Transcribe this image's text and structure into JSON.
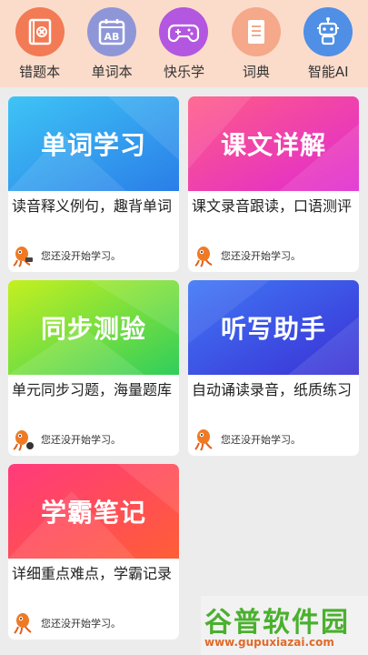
{
  "nav": {
    "items": [
      {
        "label": "错题本",
        "icon": "notebook-icon",
        "color": "#f27a55"
      },
      {
        "label": "单词本",
        "icon": "calendar-ab-icon",
        "color": "#8f96d8"
      },
      {
        "label": "快乐学",
        "icon": "gamepad-icon",
        "color": "#b356e0"
      },
      {
        "label": "词典",
        "icon": "book-icon",
        "color": "#f5a98a"
      },
      {
        "label": "智能AI",
        "icon": "robot-icon",
        "color": "#4f8fe6"
      }
    ]
  },
  "cards": [
    {
      "title": "单词学习",
      "desc": "读音释义例句，趣背单词",
      "status": "您还没开始学习。",
      "colors": [
        "#38b8f2",
        "#2e86ee"
      ]
    },
    {
      "title": "课文详解",
      "desc": "课文录音跟读，口语测评",
      "status": "您还没开始学习。",
      "colors": [
        "#ff5a8a",
        "#e02ad0"
      ]
    },
    {
      "title": "同步测验",
      "desc": "单元同步习题，海量题库",
      "status": "您还没开始学习。",
      "colors": [
        "#b6ee2a",
        "#36d25a"
      ]
    },
    {
      "title": "听写助手",
      "desc": "自动诵读录音，纸质练习",
      "status": "您还没开始学习。",
      "colors": [
        "#3d6ff5",
        "#3a36d8"
      ]
    },
    {
      "title": "学霸笔记",
      "desc": "详细重点难点，学霸记录",
      "status": "您还没开始学习。",
      "colors": [
        "#ff3d78",
        "#ff5a3a"
      ]
    }
  ],
  "watermark": {
    "brand": "谷普软件园",
    "url": "www.gupuxiazai.com"
  }
}
